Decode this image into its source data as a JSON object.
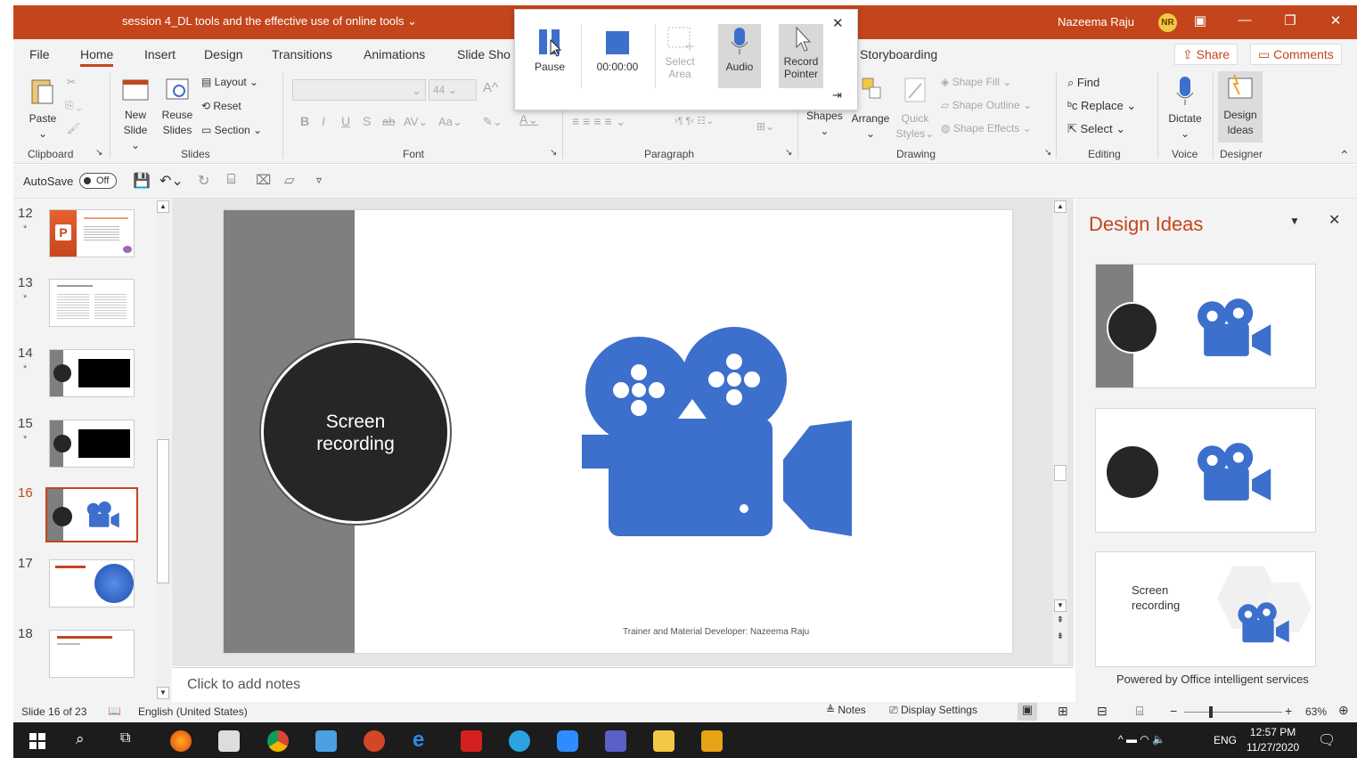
{
  "window": {
    "title": "session 4_DL tools and the effective use of online tools",
    "user_name": "Nazeema Raju",
    "user_initials": "NR"
  },
  "tabs": [
    "File",
    "Home",
    "Insert",
    "Design",
    "Transitions",
    "Animations",
    "Slide Sho",
    "Storyboarding"
  ],
  "share_label": "Share",
  "comments_label": "Comments",
  "ribbon": {
    "clipboard": {
      "paste": "Paste",
      "group": "Clipboard"
    },
    "slides": {
      "new_slide_1": "New",
      "new_slide_2": "Slide",
      "reuse_1": "Reuse",
      "reuse_2": "Slides",
      "layout": "Layout",
      "reset": "Reset",
      "section": "Section",
      "group": "Slides"
    },
    "font": {
      "size": "44",
      "group": "Font",
      "bold": "B",
      "italic": "I",
      "underline": "U",
      "shadow": "S",
      "strike": "ab",
      "spacing": "AV",
      "case": "Aa"
    },
    "paragraph": {
      "group": "Paragraph"
    },
    "drawing": {
      "shapes": "Shapes",
      "arrange": "Arrange",
      "quick_styles_1": "Quick",
      "quick_styles_2": "Styles",
      "shape_fill": "Shape Fill",
      "shape_outline": "Shape Outline",
      "shape_effects": "Shape Effects",
      "group": "Drawing"
    },
    "editing": {
      "find": "Find",
      "replace": "Replace",
      "select": "Select",
      "group": "Editing"
    },
    "voice": {
      "dictate": "Dictate",
      "group": "Voice"
    },
    "designer": {
      "design_ideas_1": "Design",
      "design_ideas_2": "Ideas",
      "group": "Designer"
    }
  },
  "qat": {
    "autosave": "AutoSave",
    "autosave_state": "Off"
  },
  "recorder": {
    "pause": "Pause",
    "time": "00:00:00",
    "select_area_1": "Select",
    "select_area_2": "Area",
    "audio": "Audio",
    "record_pointer_1": "Record",
    "record_pointer_2": "Pointer"
  },
  "thumbnails": [
    {
      "num": "12",
      "star": "*"
    },
    {
      "num": "13",
      "star": "*"
    },
    {
      "num": "14",
      "star": "*"
    },
    {
      "num": "15",
      "star": "*"
    },
    {
      "num": "16",
      "star": ""
    },
    {
      "num": "17",
      "star": ""
    },
    {
      "num": "18",
      "star": ""
    }
  ],
  "slide": {
    "circle_line1": "Screen",
    "circle_line2": "recording",
    "footer": "Trainer and Material Developer: Nazeema Raju"
  },
  "notes_placeholder": "Click to add notes",
  "design_pane": {
    "title": "Design Ideas",
    "card3_line1": "Screen",
    "card3_line2": "recording",
    "powered": "Powered by Office intelligent services"
  },
  "status": {
    "slide": "Slide 16 of 23",
    "language": "English (United States)",
    "notes": "Notes",
    "display": "Display Settings",
    "zoom": "63%"
  },
  "taskbar": {
    "lang": "ENG",
    "time": "12:57 PM",
    "date": "11/27/2020"
  },
  "colors": {
    "accent": "#c4451c",
    "camera_blue": "#3d6fcc",
    "dark_circle": "#262626",
    "gray_bar": "#7f7f7f"
  }
}
